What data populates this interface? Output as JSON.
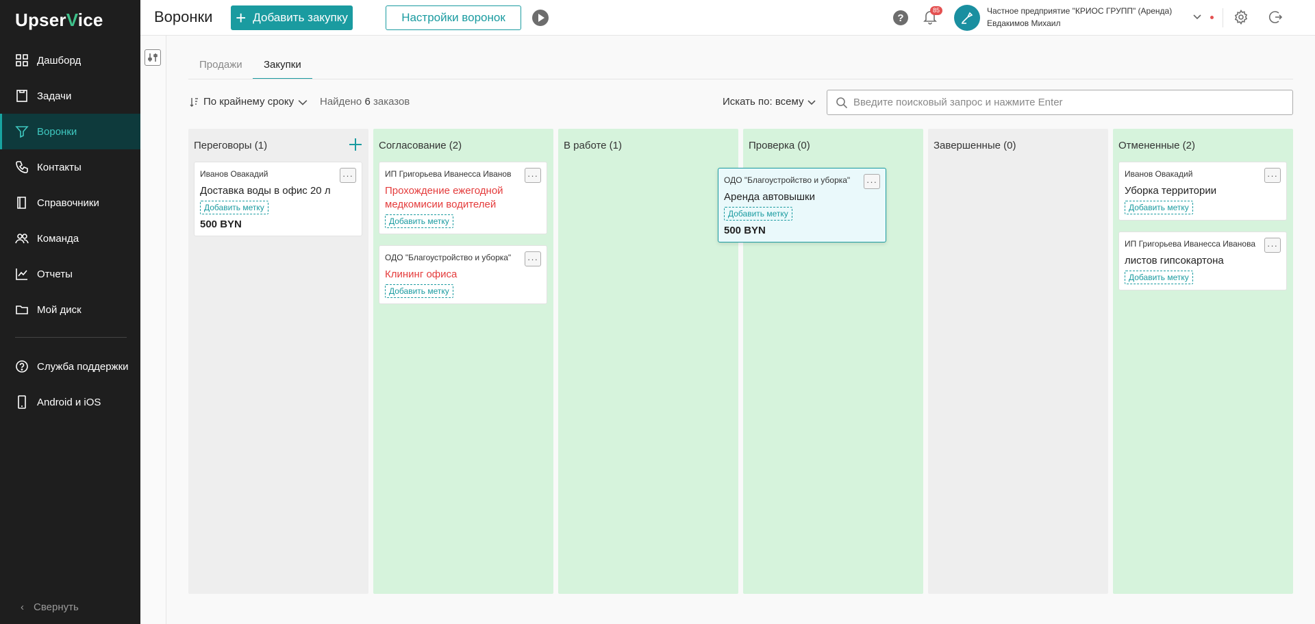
{
  "brand": {
    "logo_left": "Upser",
    "logo_check": "V",
    "logo_right": "ice"
  },
  "sidebar": {
    "items": [
      {
        "label": "Дашборд",
        "icon": "dashboard-icon"
      },
      {
        "label": "Задачи",
        "icon": "tasks-icon"
      },
      {
        "label": "Воронки",
        "icon": "funnel-icon",
        "active": true
      },
      {
        "label": "Контакты",
        "icon": "phone-icon"
      },
      {
        "label": "Справочники",
        "icon": "book-icon"
      },
      {
        "label": "Команда",
        "icon": "team-icon"
      },
      {
        "label": "Отчеты",
        "icon": "chart-icon"
      },
      {
        "label": "Мой диск",
        "icon": "folder-icon"
      }
    ],
    "secondary": [
      {
        "label": "Служба поддержки",
        "icon": "help-icon"
      },
      {
        "label": "Android и iOS",
        "icon": "mobile-icon"
      }
    ],
    "collapse_label": "Свернуть"
  },
  "header": {
    "title": "Воронки",
    "add_button": "Добавить закупку",
    "settings_button": "Настройки воронок",
    "notifications_count": "85",
    "company": "Частное предприятие \"КРИОС ГРУПП\" (Аренда)",
    "user": "Евдакимов Михаил"
  },
  "tabs": [
    {
      "label": "Продажи",
      "active": false
    },
    {
      "label": "Закупки",
      "active": true
    }
  ],
  "toolbar": {
    "sort_label": "По крайнему сроку",
    "found_prefix": "Найдено",
    "found_count": "6",
    "found_suffix": "заказов",
    "search_by": "Искать по: всему",
    "search_placeholder": "Введите поисковый запрос и нажмите Enter"
  },
  "columns": [
    {
      "title": "Переговоры (1)",
      "cards": [
        {
          "client": "Иванов Овакадий",
          "subject": "Доставка воды в офис 20 л",
          "tag": "Добавить метку",
          "price": "500 BYN"
        }
      ]
    },
    {
      "title": "Согласование (2)",
      "cards": [
        {
          "client": "ИП Григорьева Иванесса Иванов",
          "subject": "Прохождение ежегодной медкомисии водителей",
          "tag": "Добавить метку"
        },
        {
          "client": "ОДО \"Благоустройство и уборка\"",
          "subject": "Клининг офиса",
          "tag": "Добавить метку"
        }
      ]
    },
    {
      "title": "В работе (1)",
      "cards": []
    },
    {
      "title": "Проверка (0)",
      "cards": []
    },
    {
      "title": "Завершенные (0)",
      "cards": []
    },
    {
      "title": "Отмененные (2)",
      "cards": [
        {
          "client": "Иванов Овакадий",
          "subject": "Уборка территории",
          "tag": "Добавить метку"
        },
        {
          "client": "ИП Григорьева Иванесса Иванова",
          "subject": "листов гипсокартона",
          "tag": "Добавить метку"
        }
      ]
    }
  ],
  "dragged_card": {
    "client": "ОДО \"Благоустройство и уборка\"",
    "subject": "Аренда автовышки",
    "tag": "Добавить метку",
    "price": "500 BYN"
  },
  "colors": {
    "accent": "#1a9ba0",
    "sidebar": "#1e1e1e",
    "column_green": "#d6f3dc",
    "column_grey": "#eeeeee",
    "danger": "#e43b3b"
  }
}
